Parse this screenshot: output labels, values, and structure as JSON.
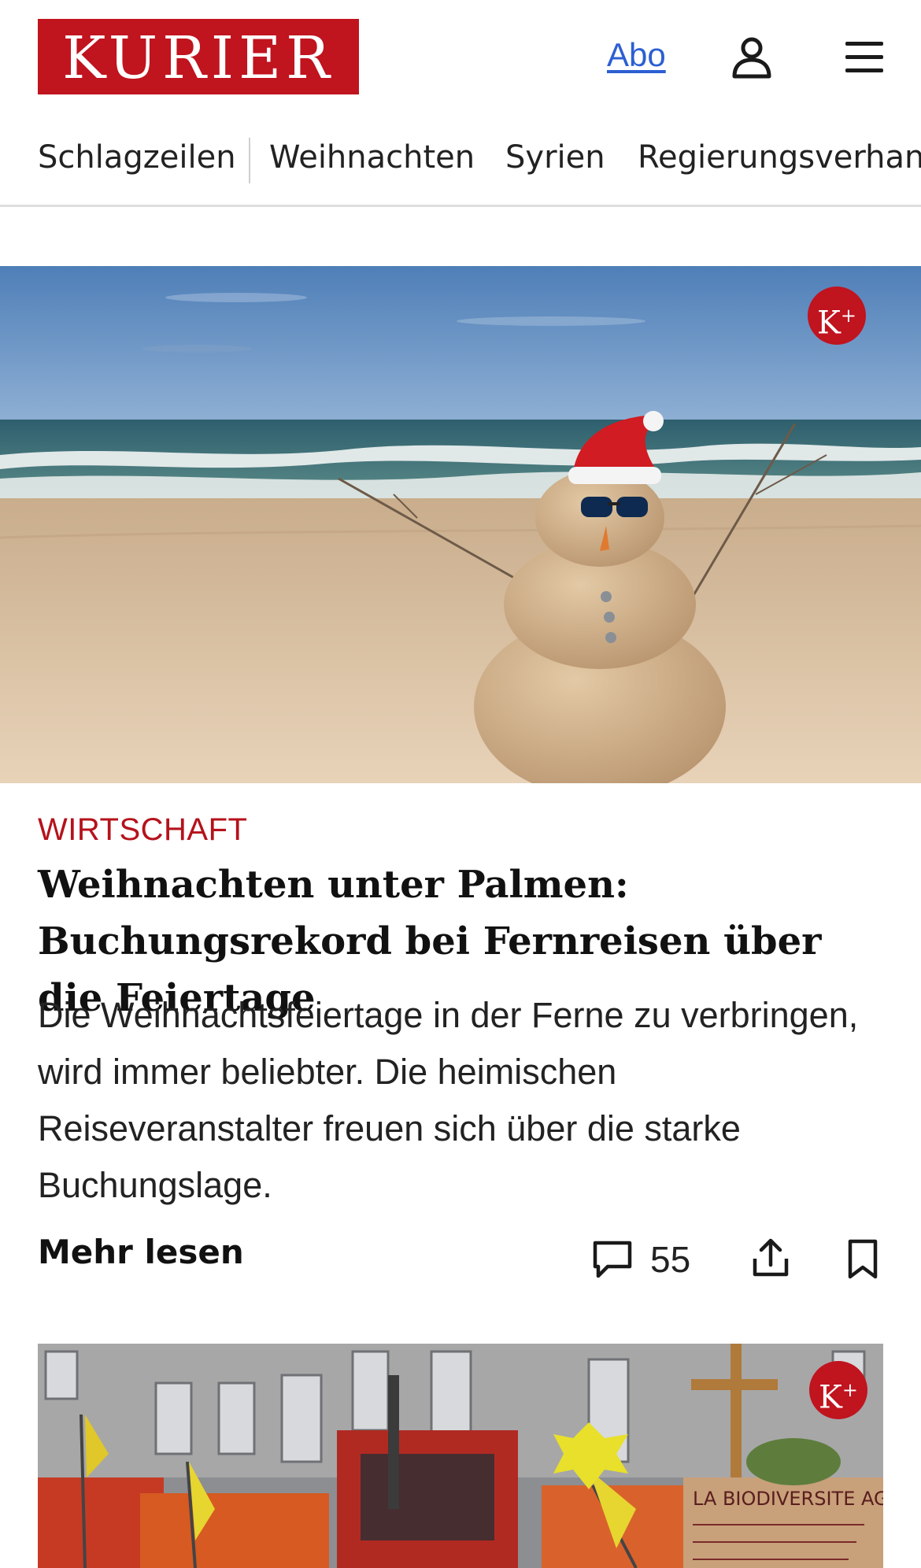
{
  "header": {
    "logo": "KURIER",
    "abo_label": "Abo",
    "user_icon": "user-icon",
    "menu_icon": "hamburger-menu-icon"
  },
  "nav": {
    "items": [
      {
        "label": "Schlagzeilen"
      },
      {
        "label": "Weihnachten"
      },
      {
        "label": "Syrien"
      },
      {
        "label": "Regierungsverhand"
      }
    ]
  },
  "article": {
    "badge": "K",
    "badge_sup": "+",
    "category": "WIRTSCHAFT",
    "headline": "Weihnachten unter Palmen: Buchungsre­kord bei Fernreisen über die Feiertage",
    "teaser": "Die Weihnachtsfeiertage in der Ferne zu verbringen, wird immer beliebter. Die heimischen Reiseveranstalter freuen sich über die starke Buchungslage.",
    "more_label": "Mehr lesen",
    "comment_count": "55"
  },
  "second_article": {
    "badge": "K",
    "badge_sup": "+",
    "sign_text": "LA BIODIVERSITE AGRICOLE"
  },
  "colors": {
    "brand_red": "#c0141f",
    "link_blue": "#2c5fd2"
  }
}
